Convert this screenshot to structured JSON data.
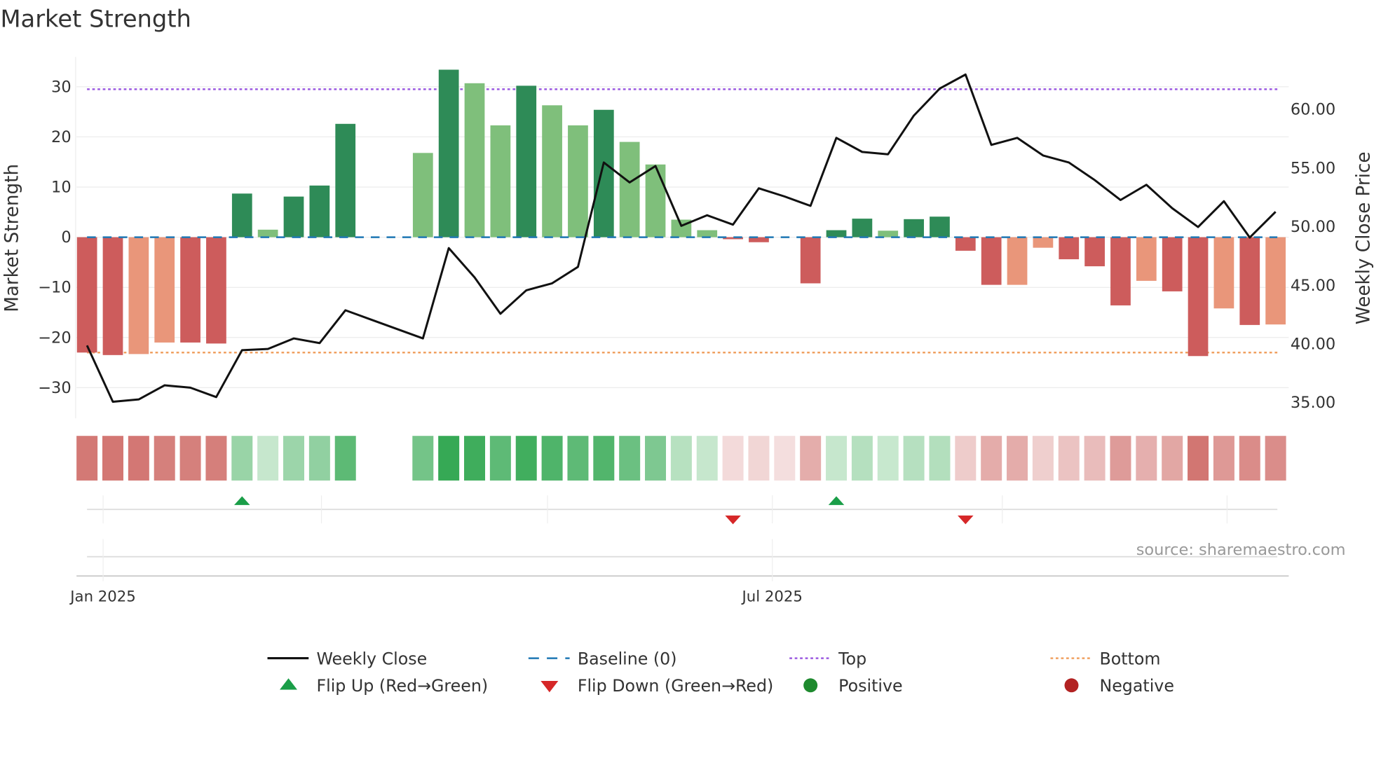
{
  "title": "Market Strength",
  "source": "source: sharemaestro.com",
  "chart_data": {
    "type": "bar",
    "title": "Market Strength",
    "ylabel": "Market Strength",
    "y2label": "Weekly Close Price",
    "ylim": [
      -36,
      36
    ],
    "y2lim": [
      33.6,
      64.4
    ],
    "yticks": [
      "30",
      "20",
      "10",
      "0",
      "−10",
      "−20",
      "−30"
    ],
    "ytick_values": [
      30,
      20,
      10,
      0,
      -10,
      -20,
      -30
    ],
    "y2ticks": [
      "60.00",
      "55.00",
      "50.00",
      "45.00",
      "40.00",
      "35.00"
    ],
    "y2tick_values": [
      60,
      55,
      50,
      45,
      40,
      35
    ],
    "xticks": [
      "Jan 2025",
      "Jul 2025"
    ],
    "xtick_weeks": [
      1.3,
      27.2
    ],
    "grid_minor_weeks": [
      1.3,
      9.75,
      18.5,
      27.2,
      36.1,
      44.8
    ],
    "top": 29.5,
    "bottom": -23,
    "baseline": 0,
    "colors": {
      "pos_strong": "#2e8b57",
      "pos_weak": "#7fbf7b",
      "neg_strong": "#cd5c5c",
      "neg_weak": "#e9967a",
      "line": "#111111",
      "top": "#9b59e0",
      "bottom": "#f0a060",
      "baseline": "#1f77b4",
      "flip_up": "#1a9e48",
      "flip_down": "#d62728",
      "positive": "#1e8a2e",
      "negative": "#b22222"
    },
    "strength": [
      -23,
      -23.5,
      -23.3,
      -21,
      -21,
      -21.2,
      8.7,
      1.5,
      8.1,
      10.3,
      22.6,
      null,
      null,
      16.8,
      33.4,
      30.7,
      22.3,
      30.2,
      26.3,
      22.3,
      25.4,
      19,
      14.5,
      3.5,
      1.4,
      -0.4,
      -1,
      0,
      -9.2,
      1.4,
      3.7,
      1.3,
      3.6,
      4.1,
      -2.7,
      -9.5,
      -9.5,
      -2.1,
      -4.4,
      -5.8,
      -13.6,
      -8.7,
      -10.8,
      -23.7,
      -14.2,
      -17.5,
      -17.4
    ],
    "shade": [
      "s",
      "s",
      "w",
      "w",
      "s",
      "s",
      "s",
      "w",
      "s",
      "s",
      "s",
      null,
      null,
      "w",
      "s",
      "w",
      "w",
      "s",
      "w",
      "w",
      "s",
      "w",
      "w",
      "w",
      "w",
      "s",
      "s",
      "s",
      "s",
      "s",
      "s",
      "w",
      "s",
      "s",
      "s",
      "s",
      "w",
      "w",
      "s",
      "s",
      "s",
      "w",
      "s",
      "s",
      "w",
      "s",
      "w"
    ],
    "weekly_close": [
      39.8,
      35.0,
      35.2,
      36.4,
      36.2,
      35.4,
      39.4,
      39.5,
      40.4,
      40.0,
      42.8,
      42.0,
      41.2,
      40.4,
      48.1,
      45.6,
      42.5,
      44.5,
      45.1,
      46.5,
      55.4,
      53.7,
      55.1,
      50.0,
      50.9,
      50.1,
      53.2,
      52.5,
      51.7,
      57.5,
      56.3,
      56.1,
      59.4,
      61.7,
      62.9,
      56.9,
      57.5,
      56.0,
      55.4,
      53.9,
      52.2,
      53.5,
      51.5,
      49.9,
      52.1,
      49.0,
      51.2
    ],
    "flip_up_weeks": [
      6,
      29
    ],
    "flip_down_weeks": [
      25,
      34
    ],
    "legend": {
      "placement": "bottom",
      "items": [
        {
          "label": "Weekly Close",
          "kind": "line"
        },
        {
          "label": "Baseline (0)",
          "kind": "baseline"
        },
        {
          "label": "Top",
          "kind": "top"
        },
        {
          "label": "Bottom",
          "kind": "bottom"
        },
        {
          "label": "Flip Up (Red→Green)",
          "kind": "flip_up"
        },
        {
          "label": "Flip Down (Green→Red)",
          "kind": "flip_down"
        },
        {
          "label": "Positive",
          "kind": "positive"
        },
        {
          "label": "Negative",
          "kind": "negative"
        }
      ]
    }
  }
}
